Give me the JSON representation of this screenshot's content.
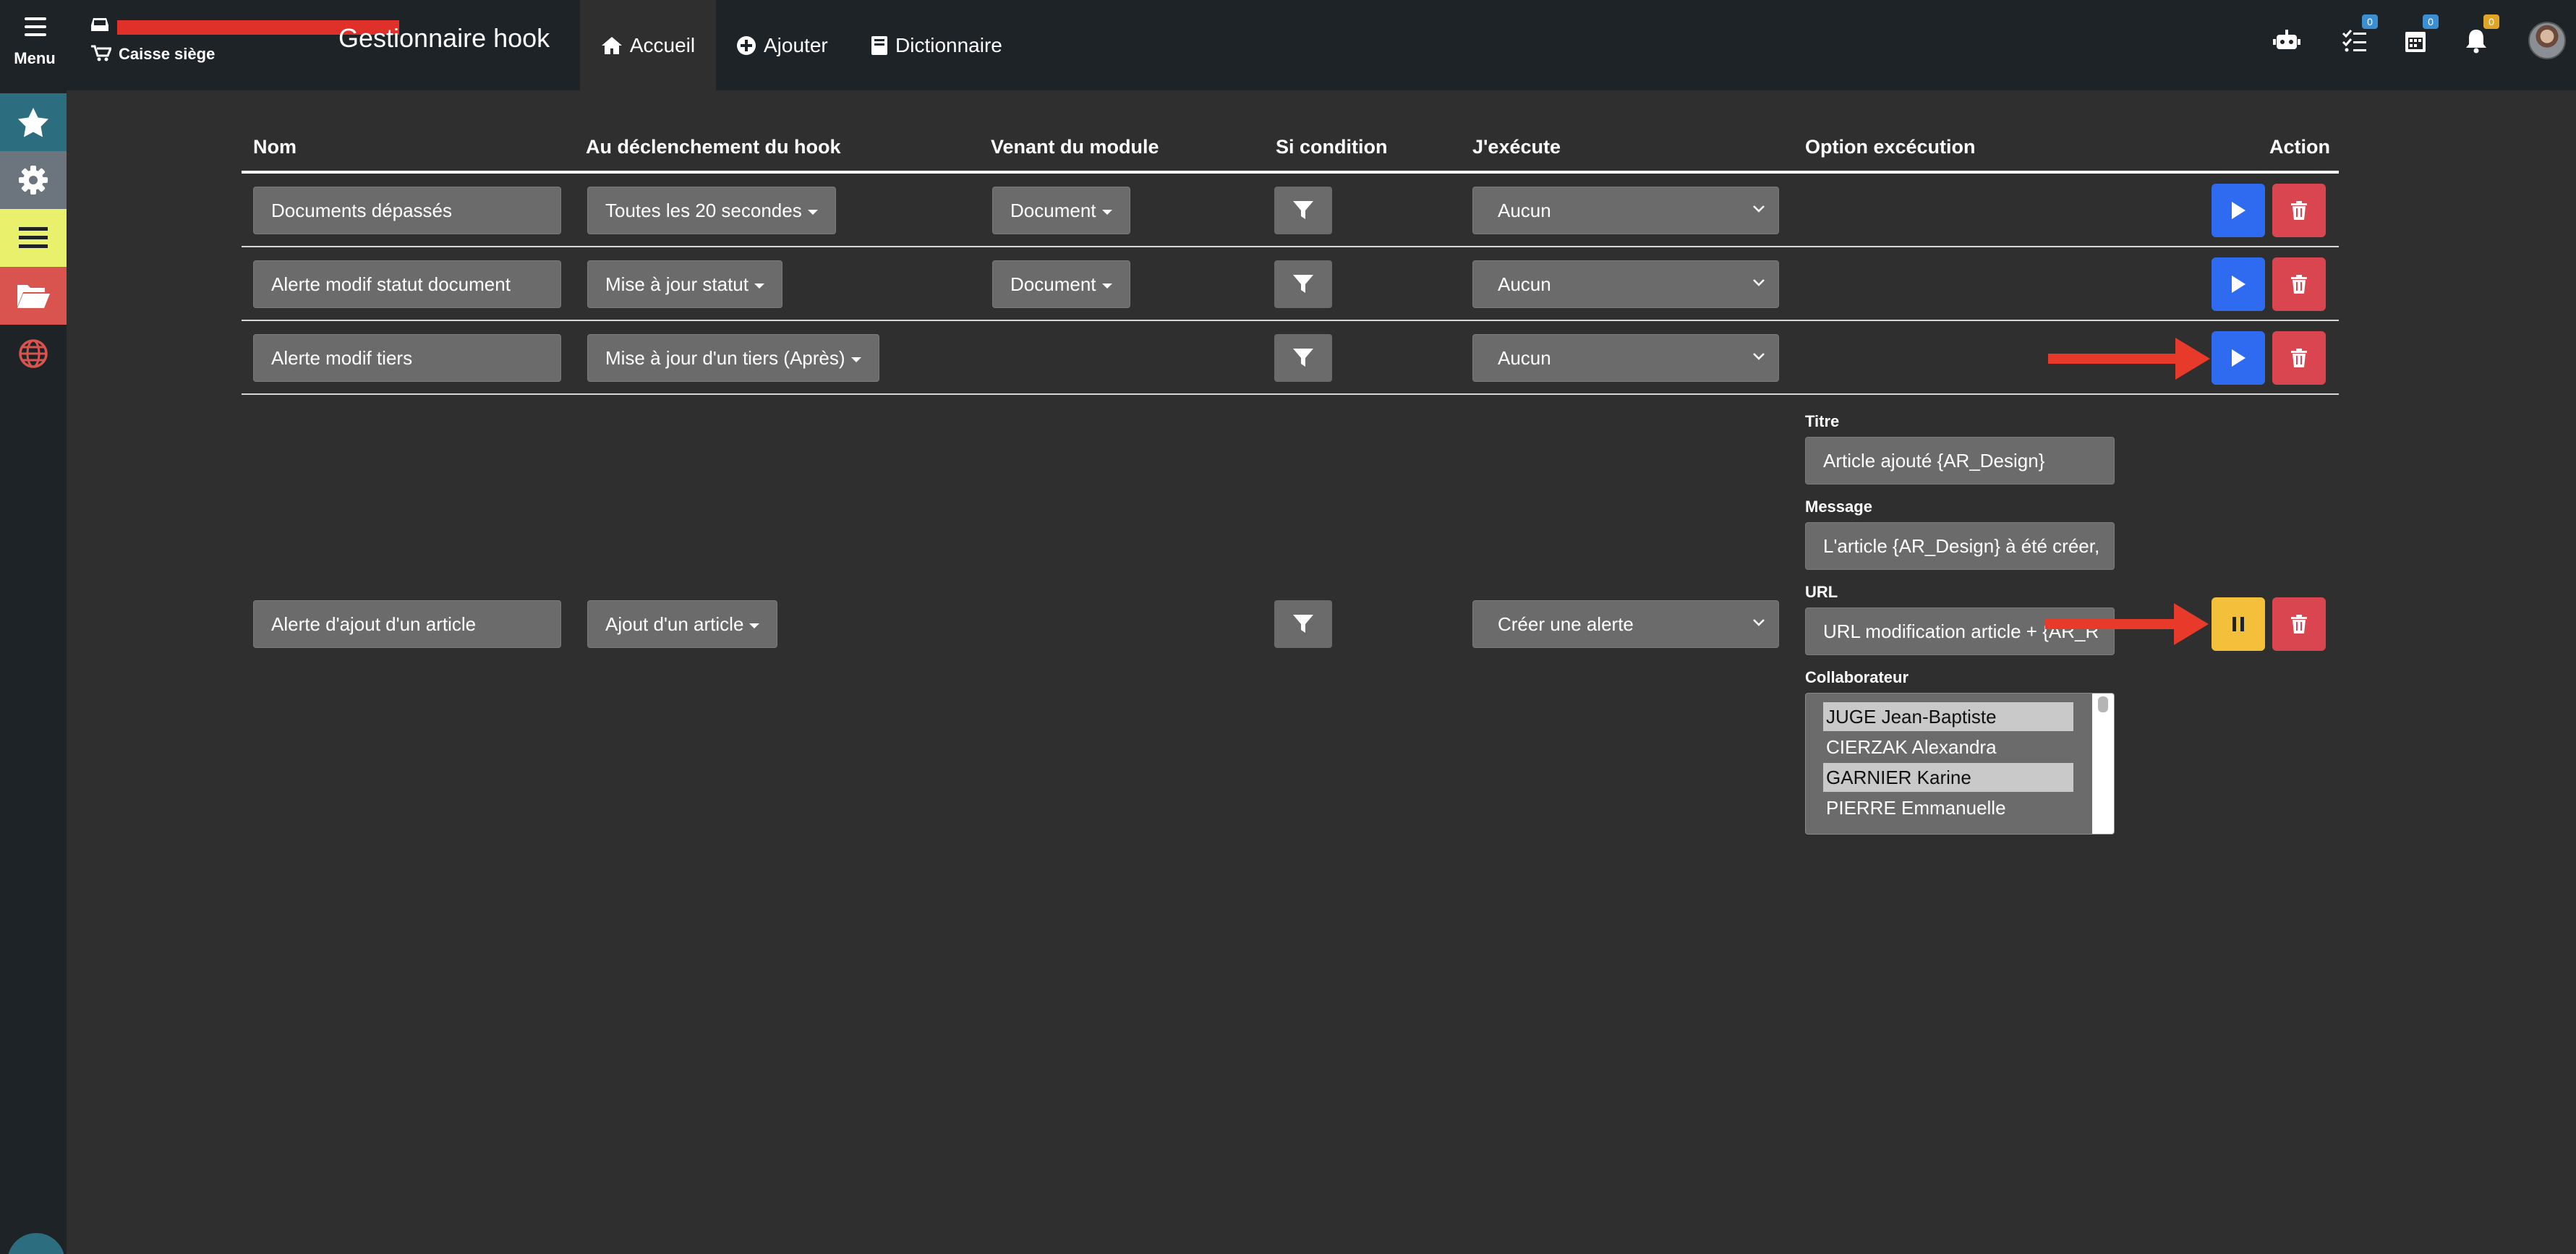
{
  "header": {
    "menu_label": "Menu",
    "store_label": "Caisse siège",
    "app_title": "Gestionnaire hook",
    "tabs": [
      {
        "label": "Accueil",
        "icon": "home-icon",
        "active": true
      },
      {
        "label": "Ajouter",
        "icon": "plus-circle-icon",
        "active": false
      },
      {
        "label": "Dictionnaire",
        "icon": "book-icon",
        "active": false
      }
    ],
    "right_icons": [
      {
        "icon": "robot-icon",
        "badge": ""
      },
      {
        "icon": "tasks-icon",
        "badge": "0",
        "badge_color": "#3b8fd1"
      },
      {
        "icon": "calendar-icon",
        "badge": "0",
        "badge_color": "#3b8fd1"
      },
      {
        "icon": "bell-icon",
        "badge": "0",
        "badge_color": "#e0a526"
      }
    ]
  },
  "sidebar": {
    "items": [
      {
        "icon": "star-icon",
        "color": "#2c6e80"
      },
      {
        "icon": "gear-icon",
        "color": "#6c757d"
      },
      {
        "icon": "list-icon",
        "color": "#e9f06b"
      },
      {
        "icon": "folder-open-icon",
        "color": "#d9534f"
      },
      {
        "icon": "globe-icon",
        "color": "#1d2327"
      }
    ]
  },
  "table": {
    "columns": [
      "Nom",
      "Au déclenchement du hook",
      "Venant du module",
      "Si condition",
      "J'exécute",
      "Option excécution",
      "Action"
    ],
    "rows": [
      {
        "name": "Documents dépassés",
        "trigger": "Toutes les 20 secondes",
        "module": "Document",
        "execute": "Aucun",
        "state": "play"
      },
      {
        "name": "Alerte modif statut document",
        "trigger": "Mise à jour statut",
        "module": "Document",
        "execute": "Aucun",
        "state": "play"
      },
      {
        "name": "Alerte modif tiers",
        "trigger": "Mise à jour d'un tiers (Après)",
        "module": "",
        "execute": "Aucun",
        "state": "play"
      },
      {
        "name": "Alerte d'ajout d'un article",
        "trigger": "Ajout d'un article",
        "module": "",
        "execute": "Créer une alerte",
        "state": "pause",
        "options": {
          "titre_label": "Titre",
          "titre_value": "Article ajouté {AR_Design}",
          "message_label": "Message",
          "message_value": "L'article {AR_Design} à été créer,",
          "url_label": "URL",
          "url_value": "URL modification article + {AR_R",
          "collab_label": "Collaborateur",
          "collaborators": [
            {
              "name": "JUGE Jean-Baptiste",
              "selected": true
            },
            {
              "name": "CIERZAK Alexandra",
              "selected": false
            },
            {
              "name": "GARNIER Karine",
              "selected": true
            },
            {
              "name": "PIERRE Emmanuelle",
              "selected": false
            }
          ]
        }
      }
    ]
  },
  "colors": {
    "play": "#2f6bf0",
    "pause": "#f4bf3a",
    "delete": "#d9464f",
    "annotation_arrow": "#e83a2a"
  }
}
